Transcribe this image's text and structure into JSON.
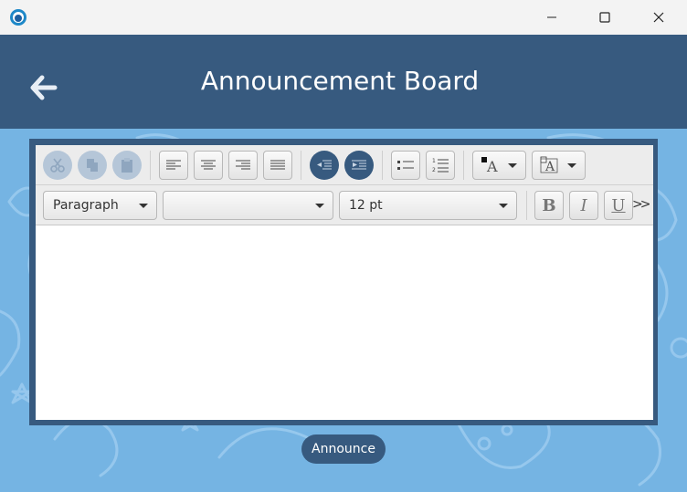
{
  "header": {
    "title": "Announcement Board"
  },
  "toolbar": {
    "block_format": "Paragraph",
    "font_family": "",
    "font_size": "12 pt",
    "more_label": ">>",
    "bold_label": "B",
    "italic_label": "I",
    "underline_label": "U"
  },
  "actions": {
    "announce_label": "Announce"
  },
  "colors": {
    "primary": "#375a7f",
    "background": "#75b4e3",
    "disabled": "#b5c6d8"
  }
}
